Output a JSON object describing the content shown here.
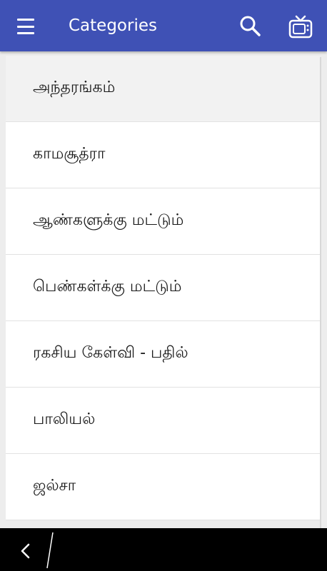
{
  "app_bar": {
    "title": "Categories",
    "background": "#3f51b5",
    "icons": {
      "menu": "hamburger-menu-icon",
      "search": "search-icon",
      "tv": "tv-icon"
    }
  },
  "categories": [
    {
      "label": "அந்தரங்கம்"
    },
    {
      "label": "காமசூத்ரா"
    },
    {
      "label": "ஆண்களுக்கு மட்டும்"
    },
    {
      "label": "பெண்கள்க்கு மட்டும்"
    },
    {
      "label": "ரகசிய கேள்வி - பதில்"
    },
    {
      "label": "பாலியல்"
    },
    {
      "label": "ஜல்சா"
    }
  ],
  "nav_bar": {
    "back_icon": "back-chevron-icon"
  }
}
